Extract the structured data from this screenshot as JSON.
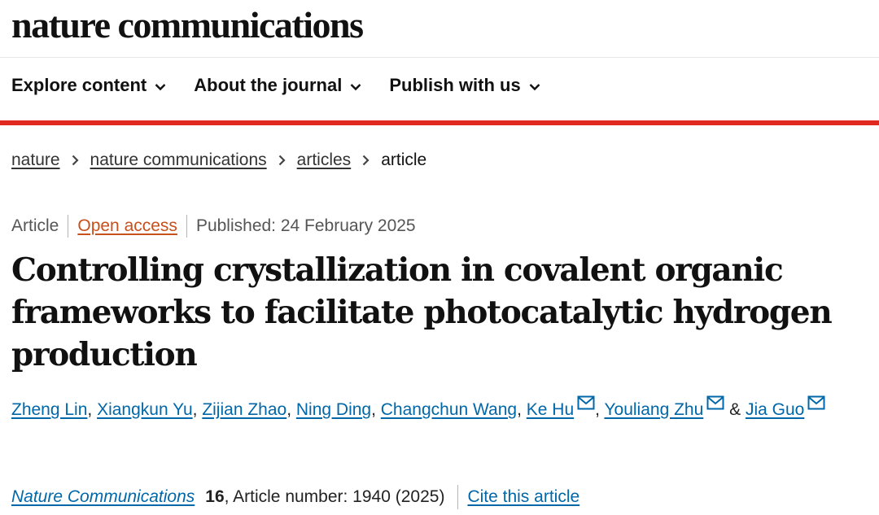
{
  "brand": {
    "name": "nature communications"
  },
  "nav": {
    "items": [
      {
        "label": "Explore content",
        "icon": "chevron-down-icon"
      },
      {
        "label": "About the journal",
        "icon": "chevron-down-icon"
      },
      {
        "label": "Publish with us",
        "icon": "chevron-down-icon"
      }
    ]
  },
  "breadcrumb": {
    "items": [
      "nature",
      "nature communications",
      "articles"
    ],
    "current": "article",
    "separator_icon": "chevron-right-icon"
  },
  "article": {
    "type": "Article",
    "access": "Open access",
    "published": "Published: 24 February 2025",
    "title": "Controlling crystallization in covalent organic frameworks to facilitate photocatalytic hydrogen production",
    "authors": [
      {
        "name": "Zheng Lin",
        "suffix": ", "
      },
      {
        "name": "Xiangkun Yu",
        "suffix": ", "
      },
      {
        "name": "Zijian Zhao",
        "suffix": ", "
      },
      {
        "name": "Ning Ding",
        "suffix": ", "
      },
      {
        "name": "Changchun Wang",
        "suffix": ", "
      },
      {
        "name": "Ke Hu",
        "suffix": ", "
      },
      {
        "name": "Youliang Zhu",
        "suffix": " & "
      },
      {
        "name": "Jia Guo",
        "suffix": ""
      }
    ],
    "corresponding_icon": "mail-icon",
    "citation": {
      "journal": "Nature Communications",
      "volume": "16",
      "details": ", Article number: 1940 (2025)",
      "cite_label": "Cite this article"
    }
  },
  "colors": {
    "accent_red": "#e0291f",
    "link_blue": "#0067a9",
    "open_access_orange": "#c8501c"
  }
}
